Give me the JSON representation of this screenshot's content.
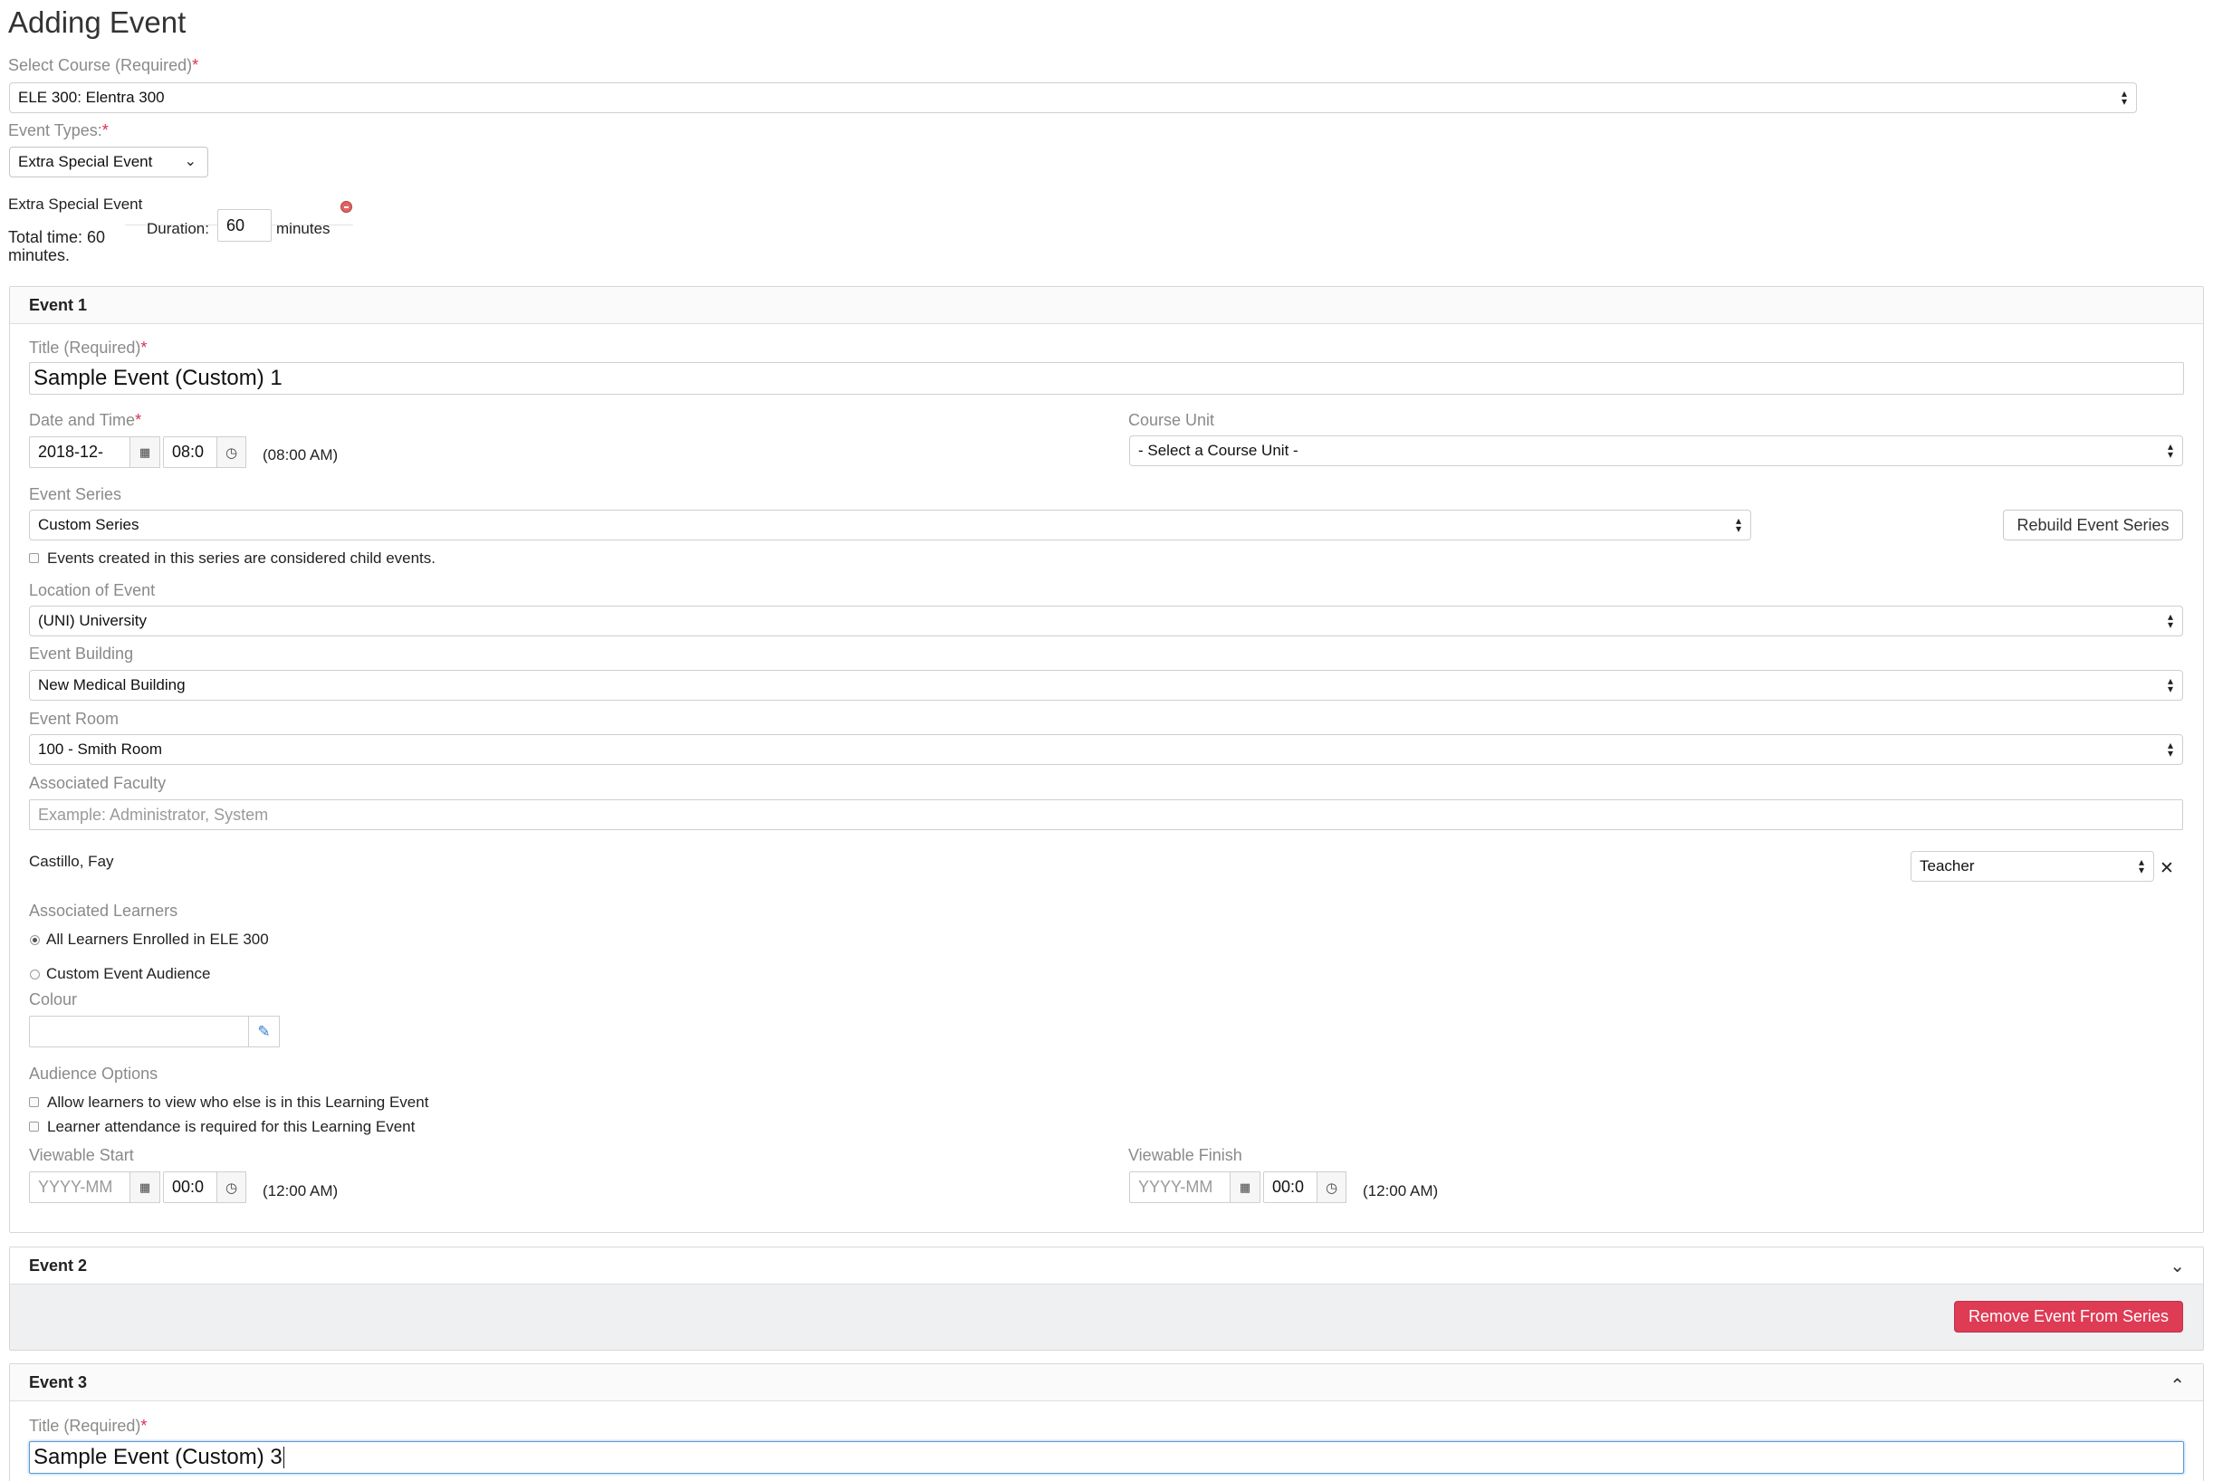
{
  "page_title": "Adding Event",
  "course": {
    "label": "Select Course (Required)",
    "required_mark": "*",
    "value": "ELE 300: Elentra 300"
  },
  "event_types": {
    "label": "Event Types:",
    "required_mark": "*",
    "value": "Extra Special Event"
  },
  "duration": {
    "event_type_name": "Extra Special Event",
    "total_time": "Total time: 60",
    "total_time_unit": "minutes.",
    "label": "Duration:",
    "value": "60",
    "unit": "minutes"
  },
  "event1": {
    "header": "Event 1",
    "title_label": "Title (Required)",
    "required_mark": "*",
    "title_value": "Sample Event (Custom) 1",
    "date_time_label": "Date and Time",
    "date_value": "2018-12-",
    "time_value": "08:0",
    "time_display": "(08:00 AM)",
    "course_unit_label": "Course Unit",
    "course_unit_value": "- Select a Course Unit -",
    "event_series_label": "Event Series",
    "event_series_value": "Custom Series",
    "rebuild_button": "Rebuild Event Series",
    "child_events_text": "Events created in this series are considered child events.",
    "location_label": "Location of Event",
    "location_value": "(UNI) University",
    "building_label": "Event Building",
    "building_value": "New Medical Building",
    "room_label": "Event Room",
    "room_value": "100 - Smith Room",
    "faculty_label": "Associated Faculty",
    "faculty_placeholder": "Example: Administrator, System",
    "faculty_name": "Castillo, Fay",
    "faculty_role": "Teacher",
    "learners_label": "Associated Learners",
    "learners_option1": "All Learners Enrolled in ELE 300",
    "learners_option2": "Custom Event Audience",
    "colour_label": "Colour",
    "audience_options_label": "Audience Options",
    "audience_option1": "Allow learners to view who else is in this Learning Event",
    "audience_option2": "Learner attendance is required for this Learning Event",
    "viewable_start_label": "Viewable Start",
    "viewable_start_date_placeholder": "YYYY-MM",
    "viewable_start_time": "00:0",
    "viewable_start_display": "(12:00 AM)",
    "viewable_finish_label": "Viewable Finish",
    "viewable_finish_date_placeholder": "YYYY-MM",
    "viewable_finish_time": "00:0",
    "viewable_finish_display": "(12:00 AM)"
  },
  "event2": {
    "header": "Event 2",
    "remove_button": "Remove Event From Series"
  },
  "event3": {
    "header": "Event 3",
    "title_label": "Title (Required)",
    "required_mark": "*",
    "title_value": "Sample Event (Custom) 3"
  },
  "colors": {
    "required": "#d9304f",
    "danger_button": "#de3b55",
    "focus_border": "#5b9bd5",
    "label_gray": "#8a8a8a"
  },
  "icons": {
    "select_arrows": "up-down-arrows-icon",
    "calendar": "calendar-icon",
    "clock": "clock-icon",
    "remove_duration": "remove-circle-icon",
    "remove_faculty": "close-icon",
    "eyedropper": "eyedropper-icon",
    "collapse": "chevron-icon"
  }
}
